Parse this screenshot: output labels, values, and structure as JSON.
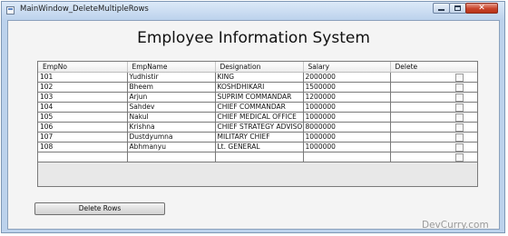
{
  "window": {
    "title": "MainWindow_DeleteMultipleRows"
  },
  "heading": "Employee Information System",
  "grid": {
    "columns": [
      "EmpNo",
      "EmpName",
      "Designation",
      "Salary",
      "Delete"
    ],
    "rows": [
      {
        "empno": "101",
        "name": "Yudhistir",
        "designation": "KING",
        "salary": "2000000",
        "delete": false
      },
      {
        "empno": "102",
        "name": "Bheem",
        "designation": "KOSHDHIKARI",
        "salary": "1500000",
        "delete": false
      },
      {
        "empno": "103",
        "name": "Arjun",
        "designation": "SUPRIM COMMANDAR",
        "salary": "1200000",
        "delete": false
      },
      {
        "empno": "104",
        "name": "Sahdev",
        "designation": "CHIEF COMMANDAR",
        "salary": "1000000",
        "delete": false
      },
      {
        "empno": "105",
        "name": "Nakul",
        "designation": "CHIEF MEDICAL OFFICE",
        "salary": "1000000",
        "delete": false
      },
      {
        "empno": "106",
        "name": "Krishna",
        "designation": "CHIEF STRATEGY ADVISO",
        "salary": "8000000",
        "delete": false
      },
      {
        "empno": "107",
        "name": "Dustdyumna",
        "designation": "MILITARY CHIEF",
        "salary": "1000000",
        "delete": false
      },
      {
        "empno": "108",
        "name": "Abhmanyu",
        "designation": "Lt. GENERAL",
        "salary": "1000000",
        "delete": false
      },
      {
        "empno": "",
        "name": "",
        "designation": "",
        "salary": "",
        "delete": false
      }
    ]
  },
  "delete_button_label": "Delete Rows",
  "watermark": "DevCurry.com"
}
